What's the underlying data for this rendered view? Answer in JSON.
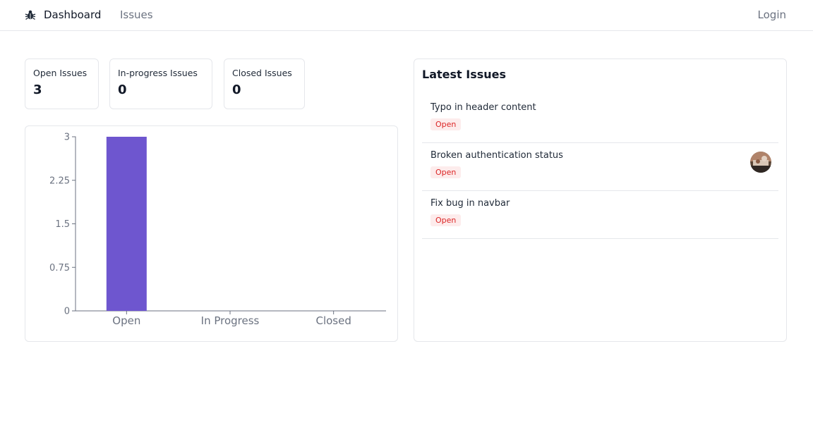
{
  "navbar": {
    "logo_icon": "bug-icon",
    "dashboard_label": "Dashboard",
    "issues_label": "Issues",
    "login_label": "Login"
  },
  "stats": {
    "open": {
      "label": "Open Issues",
      "value": "3"
    },
    "in_progress": {
      "label": "In-progress Issues",
      "value": "0"
    },
    "closed": {
      "label": "Closed Issues",
      "value": "0"
    }
  },
  "chart_data": {
    "type": "bar",
    "categories": [
      "Open",
      "In Progress",
      "Closed"
    ],
    "values": [
      3,
      0,
      0
    ],
    "ylim": [
      0,
      3
    ],
    "yticks": [
      "3",
      "2.25",
      "1.5",
      "0.75",
      "0"
    ],
    "bar_color": "#6e56cf",
    "title": "",
    "xlabel": "",
    "ylabel": ""
  },
  "latest": {
    "title": "Latest Issues",
    "issues": [
      {
        "title": "Typo in header content",
        "status": "Open",
        "has_avatar": false
      },
      {
        "title": "Broken authentication status",
        "status": "Open",
        "has_avatar": true
      },
      {
        "title": "Fix bug in navbar",
        "status": "Open",
        "has_avatar": false
      }
    ]
  },
  "colors": {
    "accent": "#6e56cf",
    "badge_text": "#dc2626",
    "badge_bg": "#fdecec",
    "border": "#e5e7eb"
  }
}
